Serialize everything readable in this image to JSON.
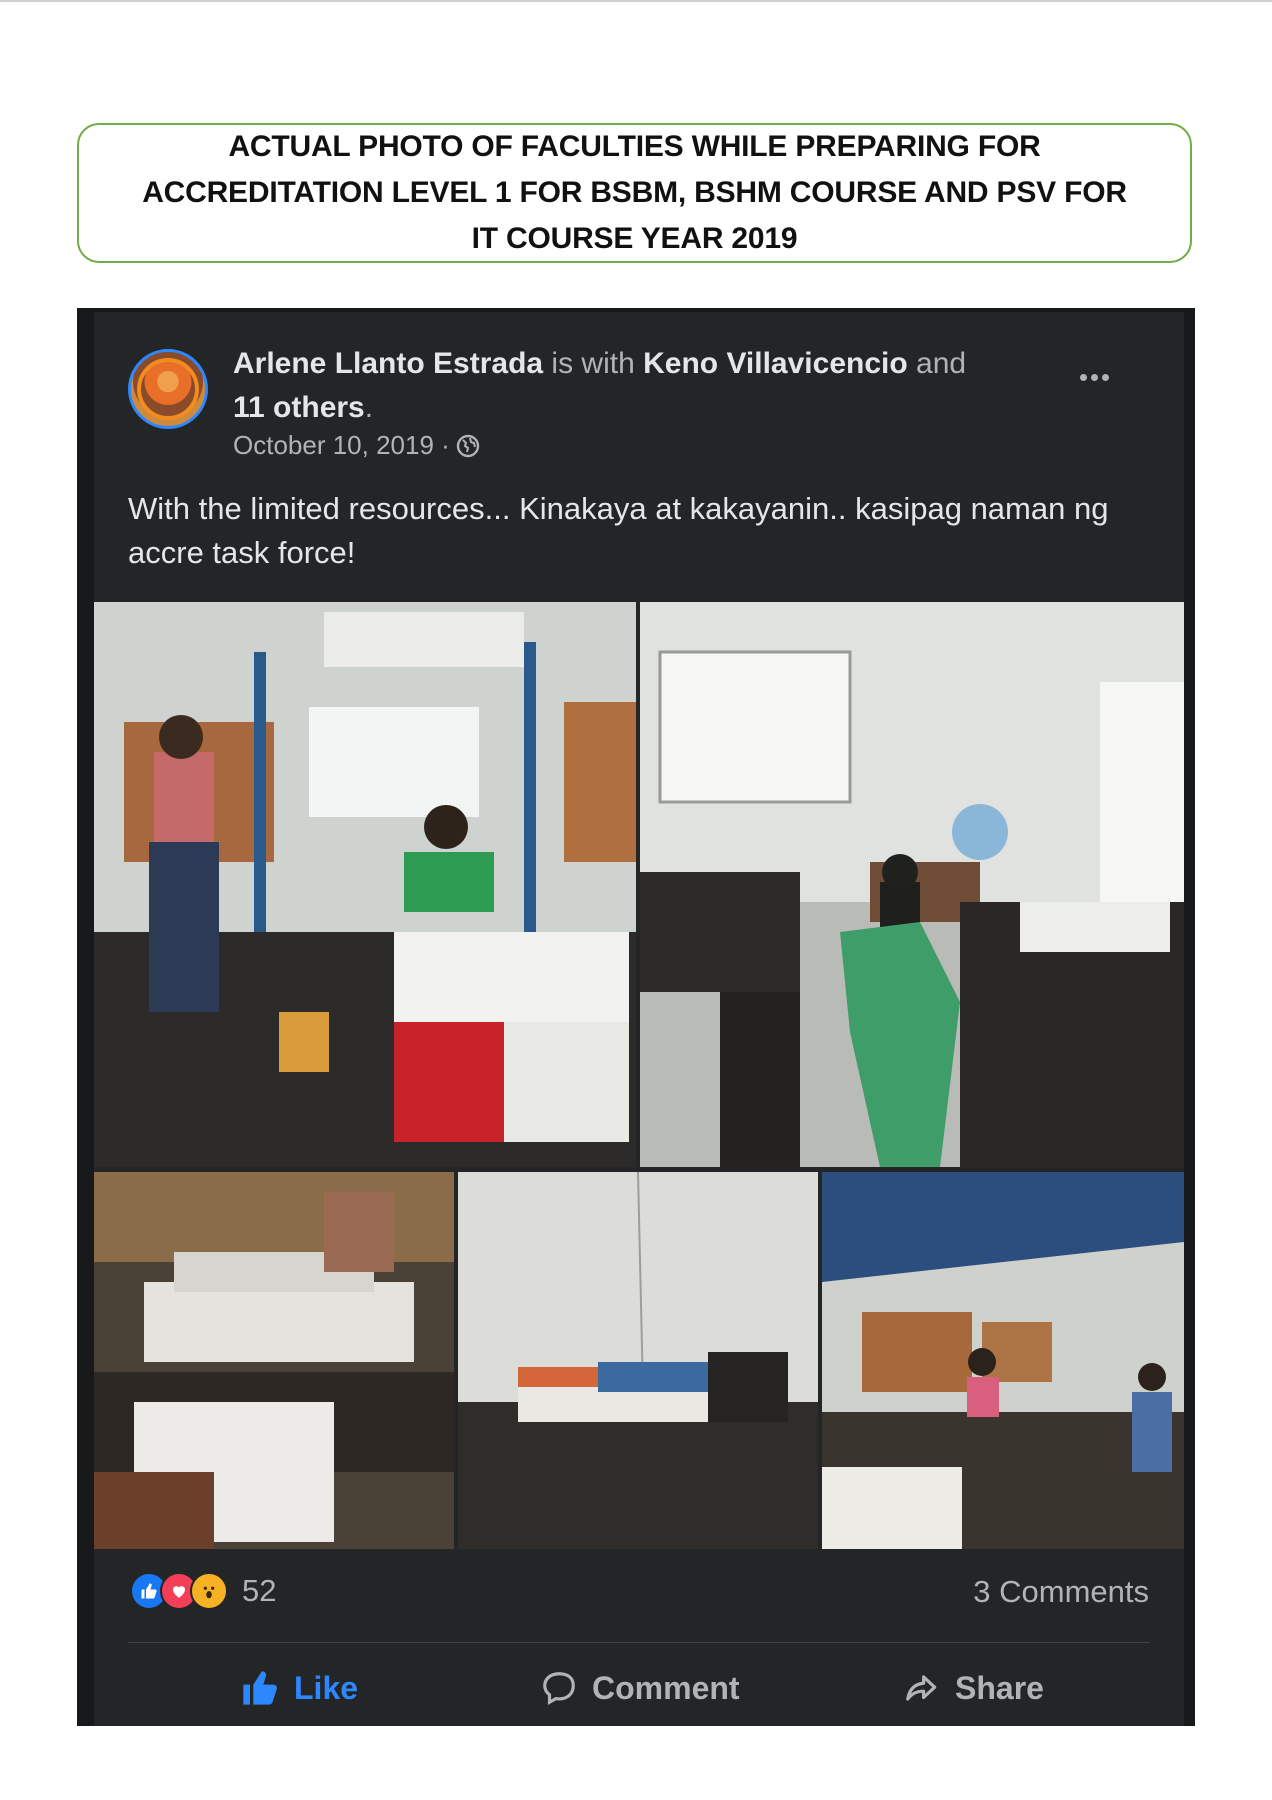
{
  "heading": {
    "line1": "ACTUAL PHOTO OF FACULTIES WHILE PREPARING FOR",
    "line2": "ACCREDITATION LEVEL 1 FOR BSBM, BSHM COURSE AND PSV FOR",
    "line3": "IT COURSE  YEAR 2019"
  },
  "post": {
    "author": "Arlene Llanto Estrada",
    "with_text": "is with",
    "tagged": "Keno Villavicencio",
    "and_text": "and",
    "others": "11 others",
    "period": ".",
    "date": "October 10, 2019 ·",
    "privacy_icon": "globe-icon",
    "more_icon": "more-horizontal-icon",
    "text": "With the limited resources... Kinakaya at kakayanin.. kasipag naman ng accre task force!",
    "reaction_icons": [
      "like-icon",
      "love-icon",
      "wow-icon"
    ],
    "reaction_count": "52",
    "comments_count": "3 Comments",
    "actions": {
      "like": "Like",
      "comment": "Comment",
      "share": "Share"
    },
    "colors": {
      "background": "#242526",
      "accent": "#2d88ff",
      "text": "#e4e6eb",
      "muted": "#b0b3b8"
    }
  }
}
